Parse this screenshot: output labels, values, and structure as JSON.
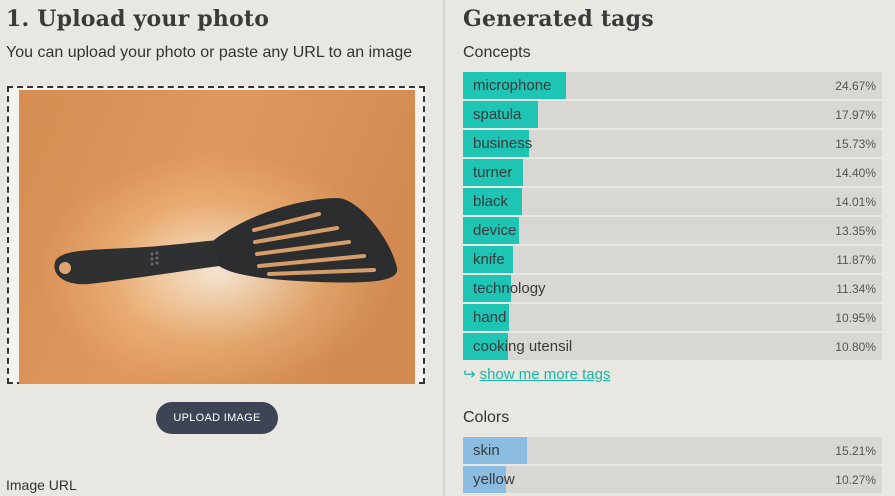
{
  "upload": {
    "title": "1. Upload your photo",
    "subtitle": "You can upload your photo or paste any URL to an image",
    "button_label": "UPLOAD IMAGE",
    "url_label": "Image URL"
  },
  "results": {
    "title": "Generated tags",
    "concepts_label": "Concepts",
    "concepts": [
      {
        "name": "microphone",
        "percent": "24.67%",
        "value": 24.67
      },
      {
        "name": "spatula",
        "percent": "17.97%",
        "value": 17.97
      },
      {
        "name": "business",
        "percent": "15.73%",
        "value": 15.73
      },
      {
        "name": "turner",
        "percent": "14.40%",
        "value": 14.4
      },
      {
        "name": "black",
        "percent": "14.01%",
        "value": 14.01
      },
      {
        "name": "device",
        "percent": "13.35%",
        "value": 13.35
      },
      {
        "name": "knife",
        "percent": "11.87%",
        "value": 11.87
      },
      {
        "name": "technology",
        "percent": "11.34%",
        "value": 11.34
      },
      {
        "name": "hand",
        "percent": "10.95%",
        "value": 10.95
      },
      {
        "name": "cooking utensil",
        "percent": "10.80%",
        "value": 10.8
      }
    ],
    "more_link": "show me more tags",
    "more_icon": "return-arrow-icon",
    "colors_label": "Colors",
    "colors": [
      {
        "name": "skin",
        "percent": "15.21%",
        "value": 15.21
      },
      {
        "name": "yellow",
        "percent": "10.27%",
        "value": 10.27
      }
    ]
  },
  "theme": {
    "concept_bar": "#1ec4b4",
    "color_bar": "#8bbde2",
    "button_bg": "#3d4554"
  }
}
